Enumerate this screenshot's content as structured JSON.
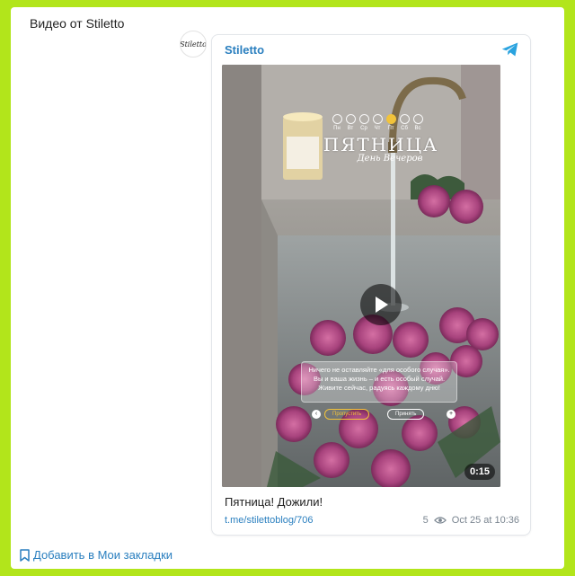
{
  "page": {
    "title": "Видео от Stiletto"
  },
  "post": {
    "channel_name": "Stiletto",
    "avatar_text": "Stiletto",
    "caption": "Пятница! Дожили!",
    "link": "t.me/stilettoblog/706",
    "views": "5",
    "date": "Oct 25 at 10:36"
  },
  "video": {
    "duration": "0:15",
    "overlay": {
      "weekdays": [
        "Пн",
        "Вт",
        "Ср",
        "Чт",
        "Пт",
        "Сб",
        "Вс"
      ],
      "active_day_index": 4,
      "day_title": "ПЯТНИЦА",
      "day_subtitle": "День Вечеров",
      "quote": "Ничего не оставляйте «для особого случая». Вы и ваша жизнь – и есть особый случай. Живите сейчас, радуясь каждому дню!",
      "skip_label": "Пропустить",
      "accept_label": "Принять"
    }
  },
  "actions": {
    "bookmark_label": "Добавить в Мои закладки"
  },
  "icons": {
    "telegram": "telegram-icon",
    "play": "play-icon",
    "views": "eye-icon",
    "bookmark": "bookmark-icon"
  },
  "colors": {
    "background": "#b2e51b",
    "link": "#2a7fbf",
    "telegram": "#2aa3df",
    "accent_day": "#f2c33a"
  }
}
